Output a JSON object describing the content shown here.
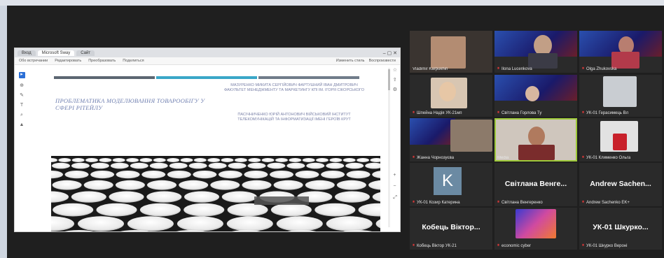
{
  "browser": {
    "tabs": [
      "Вход",
      "Microsoft Sway",
      "Сайт"
    ],
    "menu": [
      "Обо встречании",
      "Редактировать",
      "Преобразовать",
      "Поделиться"
    ],
    "menu_right": [
      "Изменить стиль",
      "Воспроизвести"
    ]
  },
  "slide": {
    "title": "ПРОБЛЕМАТИКА МОДЕЛЮВАННЯ ТОВАРООБІГУ У СФЕРІ РІТЕЙЛУ",
    "author_block_1": "МАЗУРЕНКО МИКИТА СЕРГІЙОВИЧ ФАРТУШНИЙ ІВАН ДМИТРОВИЧ ФАКУЛЬТЕТ МЕНЕДЖМЕНТУ ТА МАРКЕТИНГУ КПІ ІМ. ІГОРЯ СІКОРСЬКОГО",
    "author_block_2": "ПАСІЧНИЧЕНКО ЮРІЙ АНТОНОВИЧ ВІЙСЬКОВИЙ ІНСТИТУТ ТЕЛЕКОМУНІКАЦІЙ ТА ІНФОРМАТИЗАЦІЇ ІМЕНІ ГЕРОЇВ КРУТ",
    "stripe_colors": [
      "#5c6672",
      "#3aa7c8",
      "#707c8a"
    ]
  },
  "participants": [
    {
      "name": "Vladimir Karpukhin",
      "type": "video"
    },
    {
      "name": "Ilona Lucenkova",
      "type": "video"
    },
    {
      "name": "Olga Zhukovska",
      "type": "video"
    },
    {
      "name": "Шпейна Надія УК-21мп",
      "type": "video"
    },
    {
      "name": "Світлана Горлова Ту",
      "type": "video"
    },
    {
      "name": "УК-01 Герасимець Вл",
      "type": "video"
    },
    {
      "name": "Жанна Чорнозуєва",
      "type": "video"
    },
    {
      "name": "Media",
      "type": "video"
    },
    {
      "name": "УК-01 Клименко Ольга",
      "type": "video"
    },
    {
      "name": "УК-01 Козир Катерина",
      "type": "avatar",
      "initial": "K"
    },
    {
      "name": "Світлана Венгеренко",
      "type": "text",
      "big": "Світлана Венге..."
    },
    {
      "name": "Andrew Sachenko EK+",
      "type": "text",
      "big": "Andrew Sachen..."
    },
    {
      "name": "Кобець Віктор УК-21",
      "type": "text",
      "big": "Кобець Віктор..."
    },
    {
      "name": "economic cyber",
      "type": "video"
    },
    {
      "name": "УК-01 Шкурко Вероні",
      "type": "text",
      "big": "УК-01 Шкурко..."
    }
  ]
}
